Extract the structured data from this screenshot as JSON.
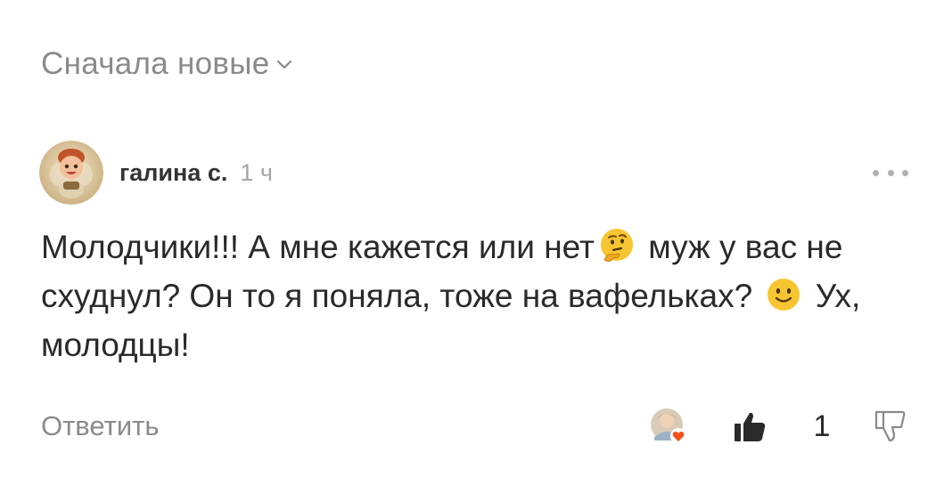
{
  "sort": {
    "label": "Сначала новые",
    "icon": "chevron-down-icon"
  },
  "comment": {
    "author": "галина с.",
    "time": "1 ч",
    "text_part1": "Молодчики!!! А мне кажется или нет",
    "text_part2": " муж у вас не схуднул? Он то я поняла, тоже на вафельках? ",
    "text_part3": " Ух, молодцы!",
    "emoji1": "thinking-face-emoji",
    "emoji2": "slightly-smiling-face-emoji"
  },
  "actions": {
    "reply_label": "Ответить",
    "like_count": "1",
    "reaction_badge_color": "#f4511e"
  },
  "colors": {
    "muted_text": "#8a8a8a",
    "main_text": "#2a2a2a",
    "emoji_yellow": "#f7c531"
  }
}
